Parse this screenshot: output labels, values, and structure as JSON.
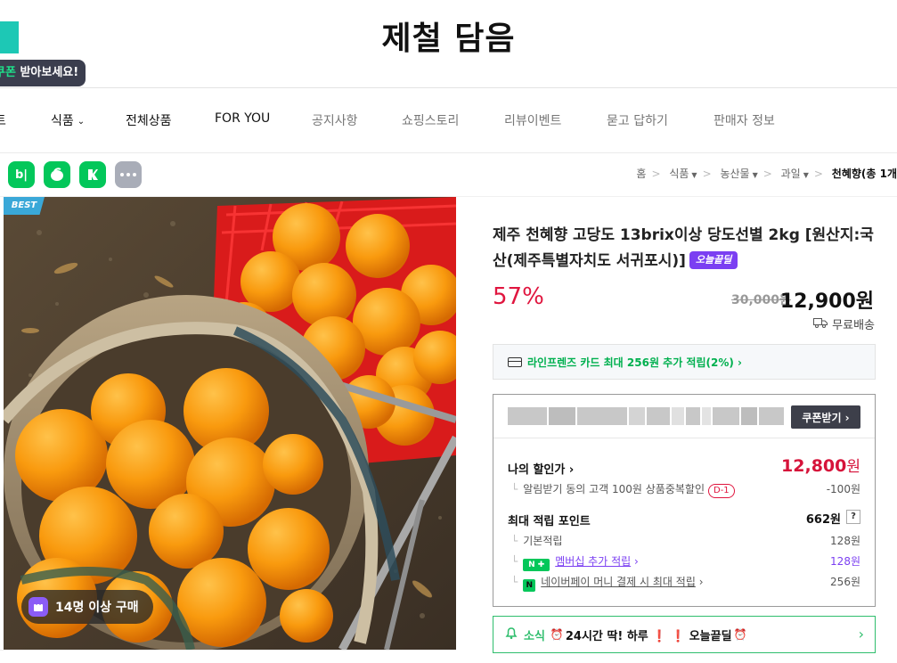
{
  "store": {
    "title": "제철 담음",
    "coupon_tip": {
      "highlight": "쿠폰",
      "text": " 받아보세요!"
    }
  },
  "nav": {
    "items": [
      {
        "label": "트",
        "dim": false
      },
      {
        "label": "식품",
        "dim": false,
        "has_chevron": true
      },
      {
        "label": "전체상품",
        "dim": false
      },
      {
        "label": "FOR YOU",
        "dim": false
      },
      {
        "label": "공지사항",
        "dim": true
      },
      {
        "label": "쇼핑스토리",
        "dim": true
      },
      {
        "label": "리뷰이벤트",
        "dim": true
      },
      {
        "label": "묻고 답하기",
        "dim": true
      },
      {
        "label": "판매자 정보",
        "dim": true
      }
    ]
  },
  "share": {
    "icons": [
      "blog-icon",
      "naver-talk-icon",
      "kakao-story-icon",
      "more-icon"
    ],
    "blog_text": "b|"
  },
  "breadcrumb": {
    "items": [
      "홈",
      "식품",
      "농산물",
      "과일"
    ],
    "current": "천혜향(총 1개"
  },
  "product": {
    "best_badge": "BEST",
    "buy_badge": "14명 이상 구매",
    "name": "제주 천혜향 고당도 13brix이상 당도선별 2kg [원산지:국산(제주특별자치도 서귀포시)]",
    "today_badge": "오늘끝딜",
    "discount": "57%",
    "original_price": "30,000원",
    "sale_price": "12,900원",
    "shipping": "무료배송"
  },
  "card_promo": "라인프렌즈 카드 최대 256원 추가 적립(2%) ›",
  "benefits": {
    "coupon_button": "쿠폰받기 ›",
    "my_price_label": "나의 할인가 ›",
    "my_price_value": "12,800",
    "my_price_unit": "원",
    "alert_discount": "알림받기 동의 고객 100원 상품중복할인",
    "alert_badge": "D-1",
    "alert_value": "-100원",
    "point_label": "최대 적립 포인트",
    "point_value": "662원",
    "point_help": "?",
    "base_point_label": "기본적립",
    "base_point_value": "128원",
    "membership_icon": "N ✚",
    "membership_label": "멤버십 추가 적립",
    "membership_arrow": " ›",
    "membership_value": "128원",
    "npay_icon": "N",
    "npay_label": "네이버페이 머니 결제 시 최대 적립",
    "npay_arrow": " ›",
    "npay_value": "256원"
  },
  "news": {
    "label": "소식",
    "text": "24시간 딱! 하루 ❗ ❗ 오늘끝딜",
    "arrow": "›"
  },
  "colors": {
    "accent_red": "#e0163f",
    "naver_green": "#03c75a",
    "purple": "#7b3ff2",
    "teal": "#1dc8b5"
  }
}
